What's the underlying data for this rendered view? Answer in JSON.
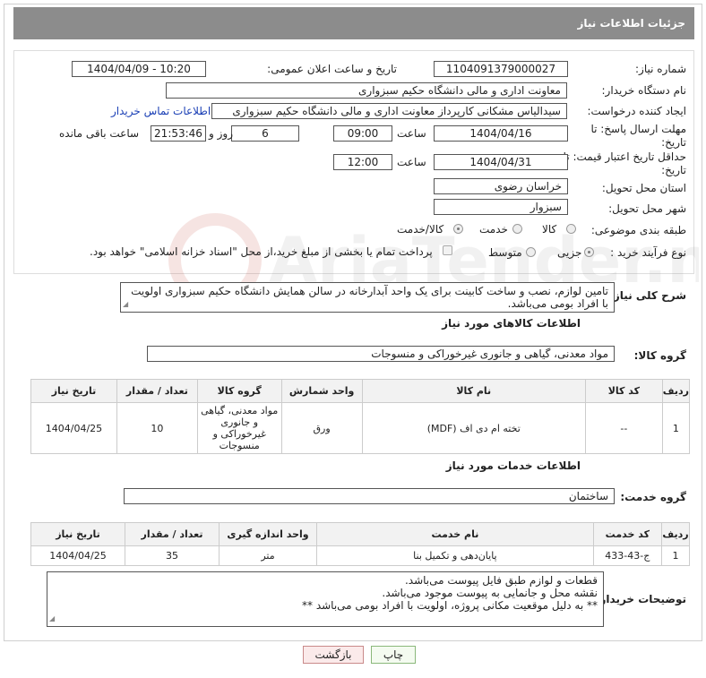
{
  "header": {
    "title": "جزئیات اطلاعات نیاز"
  },
  "form": {
    "need_number_label": "شماره نیاز:",
    "need_number": "1104091379000027",
    "announce_label": "تاریخ و ساعت اعلان عمومی:",
    "announce_value": "1404/04/09 - 10:20",
    "buyer_org_label": "نام دستگاه خریدار:",
    "buyer_org": "معاونت اداری و مالی دانشگاه حکیم سبزواری",
    "creator_label": "ایجاد کننده درخواست:",
    "creator": "سیدالیاس مشکانی کارپرداز معاونت اداری و مالی دانشگاه حکیم سبزواری",
    "contact_link": "اطلاعات تماس خریدار",
    "deadline_label": "مهلت ارسال پاسخ: تا تاریخ:",
    "deadline_date": "1404/04/16",
    "time_label": "ساعت",
    "deadline_time": "09:00",
    "days_value": "6",
    "days_label": "روز و",
    "remaining_time": "21:53:46",
    "remaining_label": "ساعت باقی مانده",
    "price_validity_label": "حداقل تاریخ اعتبار قیمت: تا تاریخ:",
    "price_date": "1404/04/31",
    "price_time": "12:00",
    "province_label": "استان محل تحویل:",
    "province": "خراسان رضوی",
    "city_label": "شهر محل تحویل:",
    "city": "سبزوار",
    "category_label": "طبقه بندی موضوعی:",
    "category_options": [
      "کالا",
      "خدمت",
      "کالا/خدمت"
    ],
    "process_label": "نوع فرآیند خرید :",
    "process_options": [
      "جزیی",
      "متوسط"
    ],
    "payment_note": "پرداخت تمام یا بخشی از مبلغ خرید،از محل \"اسناد خزانه اسلامی\" خواهد بود."
  },
  "description": {
    "label": "شرح کلی نیاز:",
    "text": "تامین لوازم، نصب و ساخت کابینت برای یک واحد آبدارخانه در سالن همایش دانشگاه حکیم سبزواری اولویت با افراد بومی می‌باشد."
  },
  "goods": {
    "section_title": "اطلاعات کالاهای مورد نیاز",
    "group_label": "گروه کالا:",
    "group_value": "مواد معدنی، گیاهی و جانوری غیرخوراکی و منسوجات",
    "headers": [
      "ردیف",
      "کد کالا",
      "نام کالا",
      "واحد شمارش",
      "گروه کالا",
      "تعداد / مقدار",
      "تاریخ نیاز"
    ],
    "rows": [
      [
        "1",
        "--",
        "تخته ام دی اف (MDF)",
        "ورق",
        "مواد معدنی، گیاهی و جانوری غیرخوراکی و منسوجات",
        "10",
        "1404/04/25"
      ]
    ]
  },
  "services": {
    "section_title": "اطلاعات خدمات مورد نیاز",
    "group_label": "گروه خدمت:",
    "group_value": "ساختمان",
    "headers": [
      "ردیف",
      "کد خدمت",
      "نام خدمت",
      "واحد اندازه گیری",
      "تعداد / مقدار",
      "تاریخ نیاز"
    ],
    "rows": [
      [
        "1",
        "ج-43-433",
        "پایان‌دهی و تکمیل بنا",
        "متر",
        "35",
        "1404/04/25"
      ]
    ]
  },
  "buyer_notes": {
    "label": "توضیحات خریدار:",
    "lines": [
      "قطعات و لوازم طبق فایل پیوست می‌باشد.",
      "نقشه محل و جانمایی به پیوست موجود می‌باشد.",
      "** به دلیل موقعیت مکانی پروژه، اولویت با افراد بومی می‌باشد **"
    ]
  },
  "buttons": {
    "print": "چاپ",
    "back": "بازگشت"
  }
}
